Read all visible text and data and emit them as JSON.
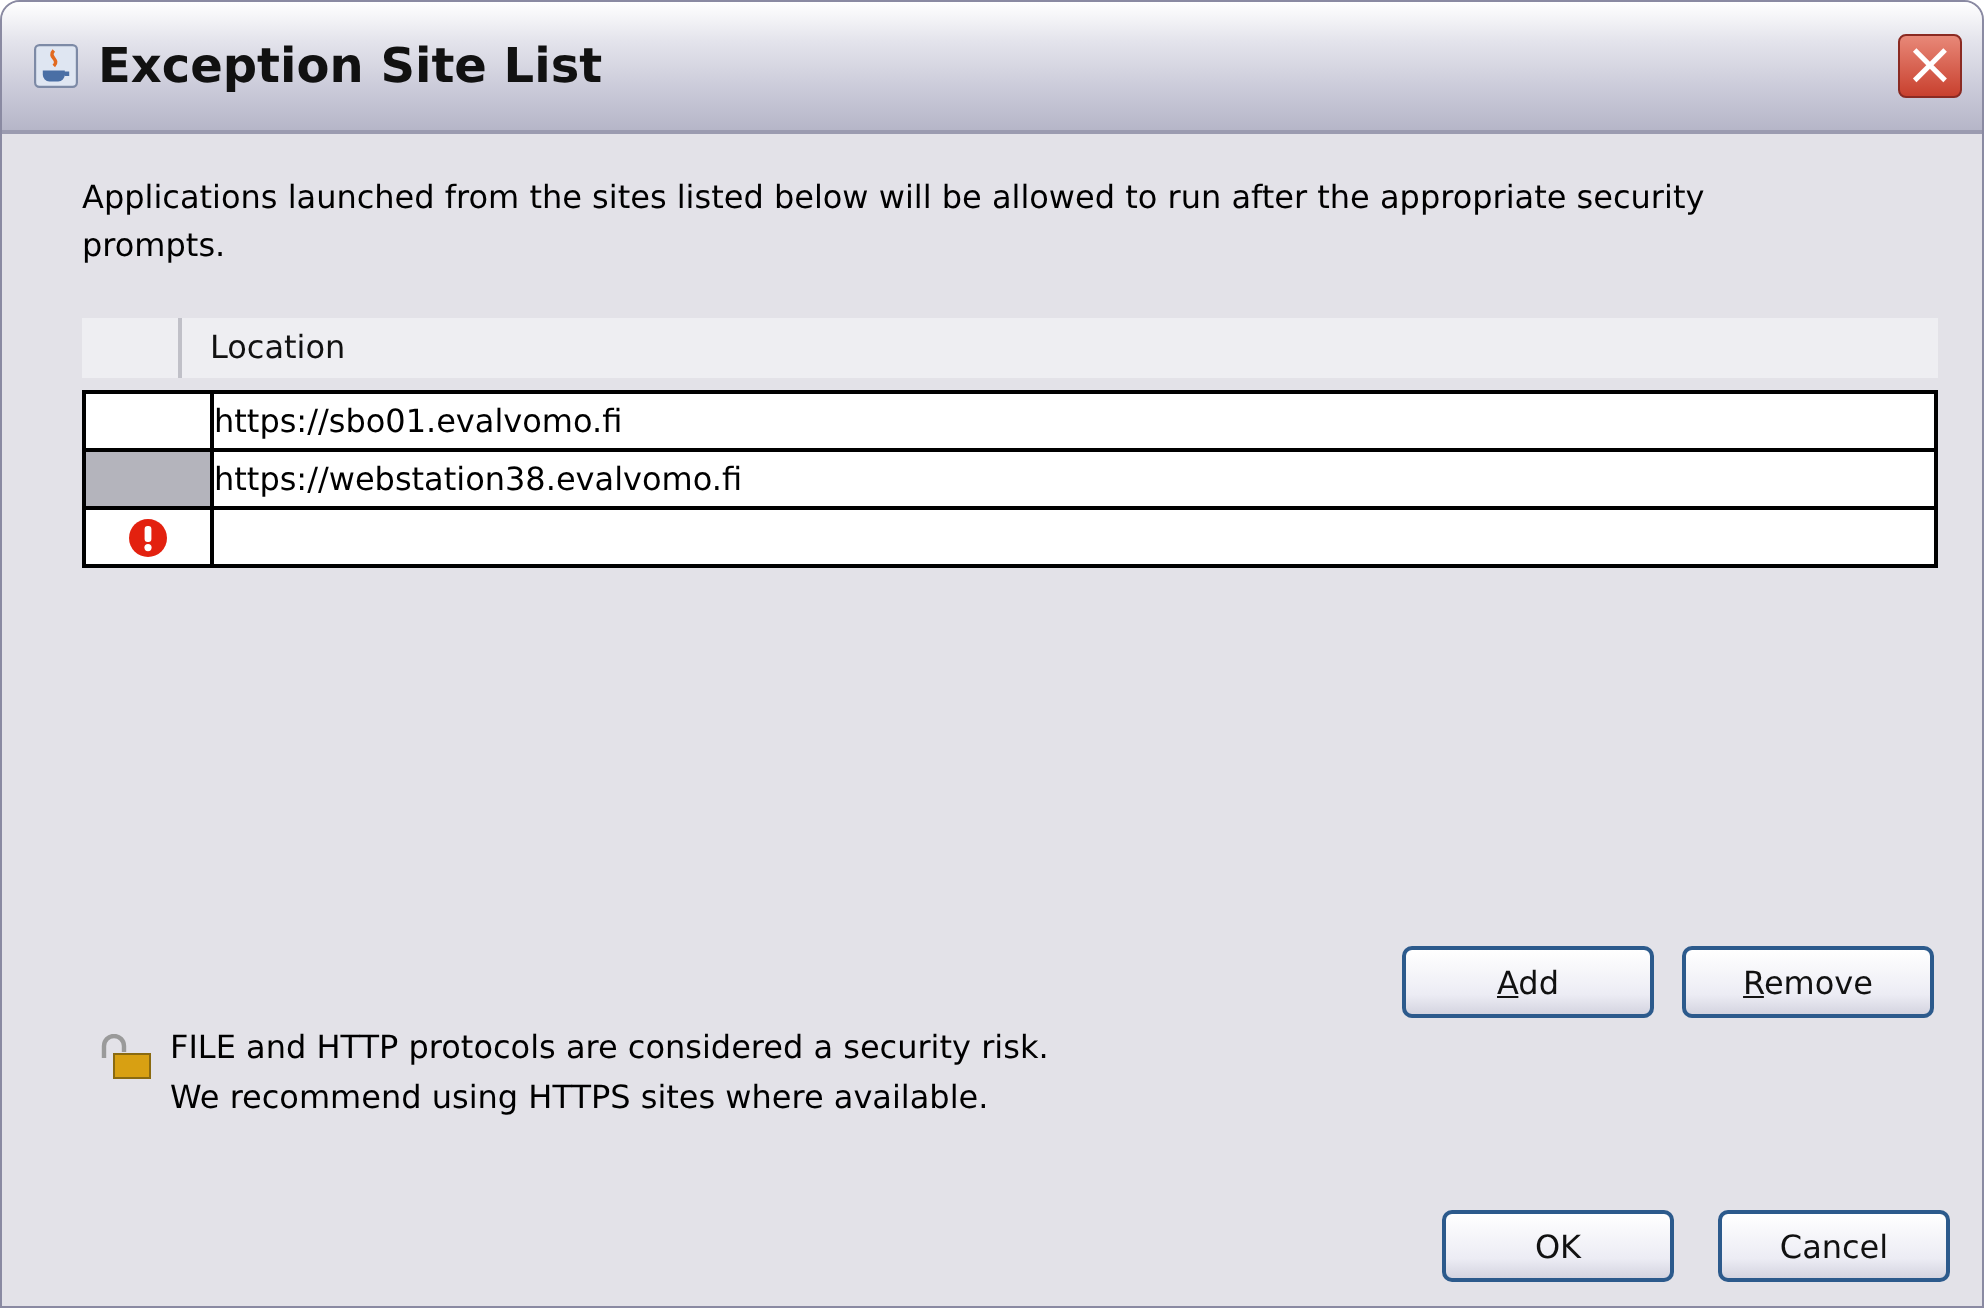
{
  "window": {
    "title": "Exception Site List",
    "close": "×"
  },
  "description": "Applications launched from the sites listed below will be allowed to run after the appropriate security prompts.",
  "table": {
    "columns": [
      "Location"
    ],
    "rows": [
      {
        "location": "https://sbo01.evalvomo.fi",
        "selected": false,
        "error": false
      },
      {
        "location": "https://webstation38.evalvomo.fi",
        "selected": true,
        "error": false
      },
      {
        "location": "",
        "selected": false,
        "error": true
      }
    ]
  },
  "list_buttons": [
    {
      "label": "Add",
      "underline_first": true
    },
    {
      "label": "Remove",
      "underline_first": true
    }
  ],
  "warning": [
    "FILE and HTTP protocols are considered a security risk.",
    "We recommend using HTTPS sites where available."
  ],
  "dialog_buttons": [
    {
      "label": "OK"
    },
    {
      "label": "Cancel"
    }
  ]
}
